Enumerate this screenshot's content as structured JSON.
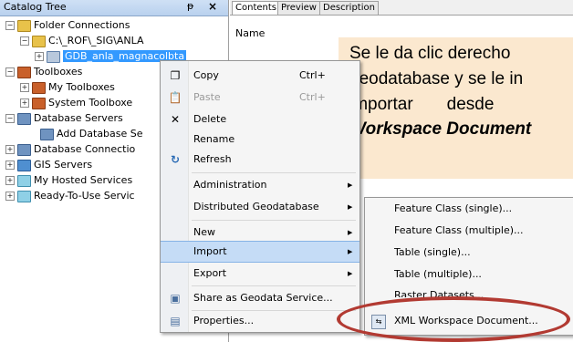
{
  "catalog": {
    "title": "Catalog Tree",
    "pin_symbol": "ᵽ",
    "close_symbol": "×",
    "nodes": [
      {
        "label": "Folder Connections",
        "expander": "−"
      },
      {
        "label": "C:\\_ROF\\_SIG\\ANLA",
        "expander": "−"
      },
      {
        "label": "GDB_anla_magnacolbta",
        "expander": "+"
      },
      {
        "label": "Toolboxes",
        "expander": "−"
      },
      {
        "label": "My Toolboxes",
        "expander": "+"
      },
      {
        "label": "System Toolboxe",
        "expander": "+"
      },
      {
        "label": "Database Servers",
        "expander": "−"
      },
      {
        "label": "Add Database Se",
        "expander": ""
      },
      {
        "label": "Database Connectio",
        "expander": "+"
      },
      {
        "label": "GIS Servers",
        "expander": "+"
      },
      {
        "label": "My Hosted Services",
        "expander": "+"
      },
      {
        "label": "Ready-To-Use Servic",
        "expander": "+"
      }
    ]
  },
  "tabs": [
    {
      "label": "Contents",
      "active": true
    },
    {
      "label": "Preview",
      "active": false
    },
    {
      "label": "Description",
      "active": false
    }
  ],
  "contents_header": "Name",
  "context_menu": {
    "items": [
      {
        "label": "Copy",
        "shortcut": "Ctrl+",
        "icon": "copy-icon",
        "glyph": "❐",
        "disabled": false,
        "submenu": false
      },
      {
        "label": "Paste",
        "shortcut": "Ctrl+",
        "icon": "paste-icon",
        "glyph": "📋",
        "disabled": true,
        "submenu": false
      },
      {
        "label": "Delete",
        "shortcut": "",
        "icon": "delete-icon",
        "glyph": "✕",
        "disabled": false,
        "submenu": false
      },
      {
        "label": "Rename",
        "shortcut": "",
        "icon": "",
        "glyph": "",
        "disabled": false,
        "submenu": false
      },
      {
        "label": "Refresh",
        "shortcut": "",
        "icon": "refresh-icon",
        "glyph": "↻",
        "disabled": false,
        "submenu": false
      },
      {
        "label": "Administration",
        "shortcut": "",
        "icon": "",
        "glyph": "",
        "disabled": false,
        "submenu": true
      },
      {
        "label": "Distributed Geodatabase",
        "shortcut": "",
        "icon": "",
        "glyph": "",
        "disabled": false,
        "submenu": true
      },
      {
        "label": "New",
        "shortcut": "",
        "icon": "",
        "glyph": "",
        "disabled": false,
        "submenu": true
      },
      {
        "label": "Import",
        "shortcut": "",
        "icon": "",
        "glyph": "",
        "disabled": false,
        "submenu": true,
        "highlighted": true
      },
      {
        "label": "Export",
        "shortcut": "",
        "icon": "",
        "glyph": "",
        "disabled": false,
        "submenu": true
      },
      {
        "label": "Share as Geodata Service...",
        "shortcut": "",
        "icon": "share-service-icon",
        "glyph": "▣",
        "disabled": false,
        "submenu": false
      },
      {
        "label": "Properties...",
        "shortcut": "",
        "icon": "properties-icon",
        "glyph": "▤",
        "disabled": false,
        "submenu": false
      }
    ]
  },
  "import_submenu": {
    "items": [
      {
        "label": "Feature Class (single)..."
      },
      {
        "label": "Feature Class (multiple)..."
      },
      {
        "label": "Table (single)..."
      },
      {
        "label": "Table (multiple)..."
      },
      {
        "label": "Raster Datasets..."
      },
      {
        "label": "XML Workspace Document..."
      }
    ]
  },
  "callout": {
    "line1": "Se le da clic derecho",
    "line2": "geodatabase y se le in",
    "line3": "importar       desde",
    "line4": "Workspace Document",
    "background": "#fbe8cf"
  },
  "highlight_color": "#b23a32"
}
